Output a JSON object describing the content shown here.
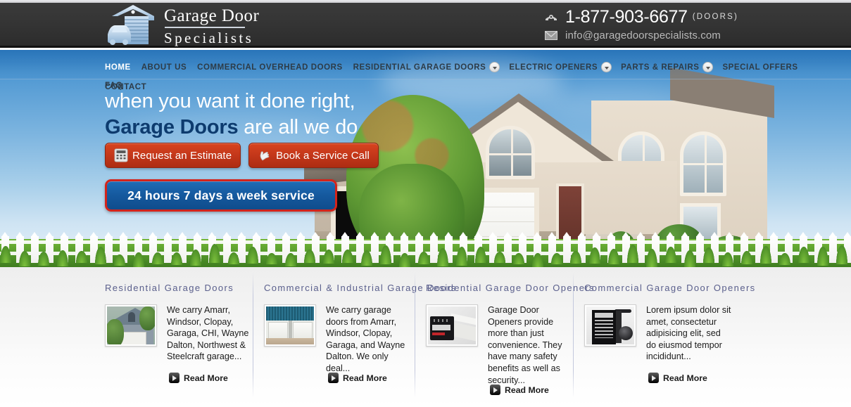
{
  "site": {
    "logo_line1": "Garage Door",
    "logo_line2": "Specialists",
    "logo_icon": "garage-car-logo-icon"
  },
  "contact": {
    "phone_icon": "telephone-icon",
    "phone": "1-877-903-6677",
    "phone_word": "(DOORS)",
    "email_icon": "envelope-icon",
    "email": "info@garagedoorspecialists.com"
  },
  "nav": {
    "items": [
      {
        "label": "HOME",
        "active": true,
        "caret": false
      },
      {
        "label": "ABOUT US",
        "active": false,
        "caret": false
      },
      {
        "label": "COMMERCIAL OVERHEAD DOORS",
        "active": false,
        "caret": false
      },
      {
        "label": "RESIDENTIAL GARAGE DOORS",
        "active": false,
        "caret": true
      },
      {
        "label": "ELECTRIC OPENERS",
        "active": false,
        "caret": true
      },
      {
        "label": "PARTS & REPAIRS",
        "active": false,
        "caret": true
      },
      {
        "label": "SPECIAL OFFERS",
        "active": false,
        "caret": false
      },
      {
        "label": "FAQ",
        "active": false,
        "caret": false
      }
    ],
    "row2": [
      {
        "label": "CONTACT",
        "active": false,
        "caret": false
      }
    ]
  },
  "hero": {
    "headline_line1": "when you want it done right,",
    "headline_strong": "Garage Doors",
    "headline_rest": " are all we do",
    "buttons": [
      {
        "label": "Request an Estimate",
        "icon": "calculator-icon"
      },
      {
        "label": "Book a Service Call",
        "icon": "hand-pointer-icon"
      }
    ],
    "banner": "24 hours 7 days a week service",
    "banner_border_color": "#d4241b",
    "banner_fill_color": "#15599e"
  },
  "cards": [
    {
      "title": "Residential  Garage  Doors",
      "thumb": "residential-house-garage-thumb",
      "text": "We carry Amarr, Windsor, Clopay, Garaga, CHI, Wayne Dalton, Northwest & Steelcraft garage...",
      "read_more": "Read More"
    },
    {
      "title": "Commercial  &  Industrial  Garage  Doors",
      "thumb": "commercial-overhead-doors-thumb",
      "text": "We carry garage doors from Amarr, Windsor, Clopay, Garaga, and Wayne Dalton. We only deal...",
      "read_more": "Read More"
    },
    {
      "title": "Residential  Garage  Door  Openers",
      "thumb": "liftmaster-opener-thumb",
      "text": "Garage Door Openers provide more than just convenience. They have many safety benefits as well as security...",
      "read_more": "Read More"
    },
    {
      "title": "Commercial  Garage  Door  Openers",
      "thumb": "commercial-opener-thumb",
      "text": "Lorem ipsum dolor sit amet, consectetur adipisicing elit, sed do eiusmod tempor incididunt...",
      "read_more": "Read More"
    }
  ],
  "colors": {
    "header_dark": "#353535",
    "nav_text": "#2d3b47",
    "hero_sky_top": "#2f7ec4",
    "accent_blue": "#0d3b6e",
    "button_red": "#c3371a",
    "card_title": "#5a5f8c"
  }
}
